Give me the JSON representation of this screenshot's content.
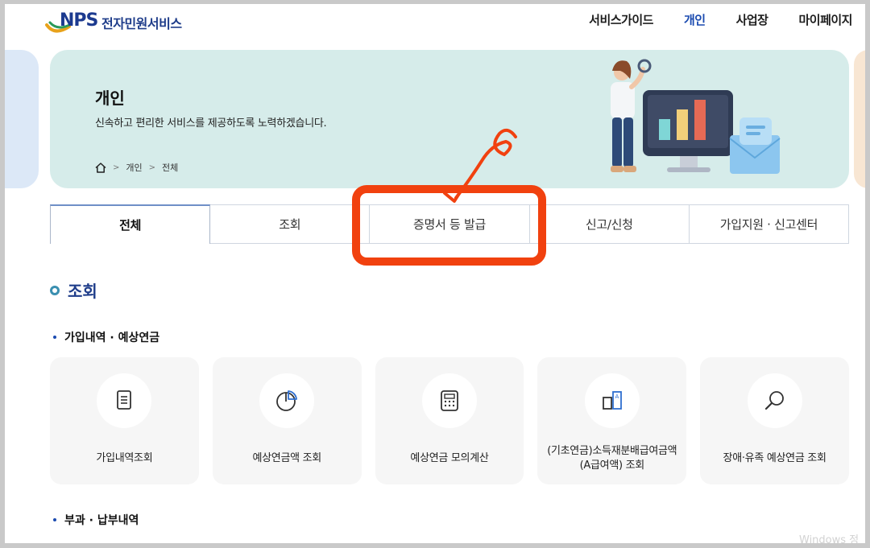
{
  "header": {
    "logo_text": "NPS",
    "site_title": "전자민원서비스",
    "nav": [
      {
        "label": "서비스가이드",
        "active": false
      },
      {
        "label": "개인",
        "active": true
      },
      {
        "label": "사업장",
        "active": false
      },
      {
        "label": "마이페이지",
        "active": false
      }
    ]
  },
  "hero": {
    "title": "개인",
    "description": "신속하고 편리한 서비스를 제공하도록 노력하겠습니다.",
    "breadcrumb": [
      "개인",
      "전체"
    ]
  },
  "tabs": [
    {
      "label": "전체",
      "active": true
    },
    {
      "label": "조회",
      "active": false
    },
    {
      "label": "증명서 등 발급",
      "active": false
    },
    {
      "label": "신고/신청",
      "active": false
    },
    {
      "label": "가입지원 · 신고센터",
      "active": false
    }
  ],
  "section": {
    "title": "조회",
    "subsections": [
      {
        "title": "가입내역 · 예상연금",
        "cards": [
          {
            "label": "가입내역조회",
            "icon": "document-icon"
          },
          {
            "label": "예상연금액 조회",
            "icon": "pie-chart-icon"
          },
          {
            "label": "예상연금 모의계산",
            "icon": "calculator-icon"
          },
          {
            "label": "(기초연금)소득재분배급여금액(A급여액) 조회",
            "icon": "document-compare-icon"
          },
          {
            "label": "장애·유족 예상연금 조회",
            "icon": "magnifier-icon"
          }
        ]
      },
      {
        "title": "부과 · 납부내역"
      }
    ]
  },
  "watermark": "Windows 정",
  "colors": {
    "brand_blue": "#1f3d8a",
    "nav_active": "#1b4bb0",
    "hero_bg": "#d6ecea",
    "highlight": "#f1410f"
  }
}
